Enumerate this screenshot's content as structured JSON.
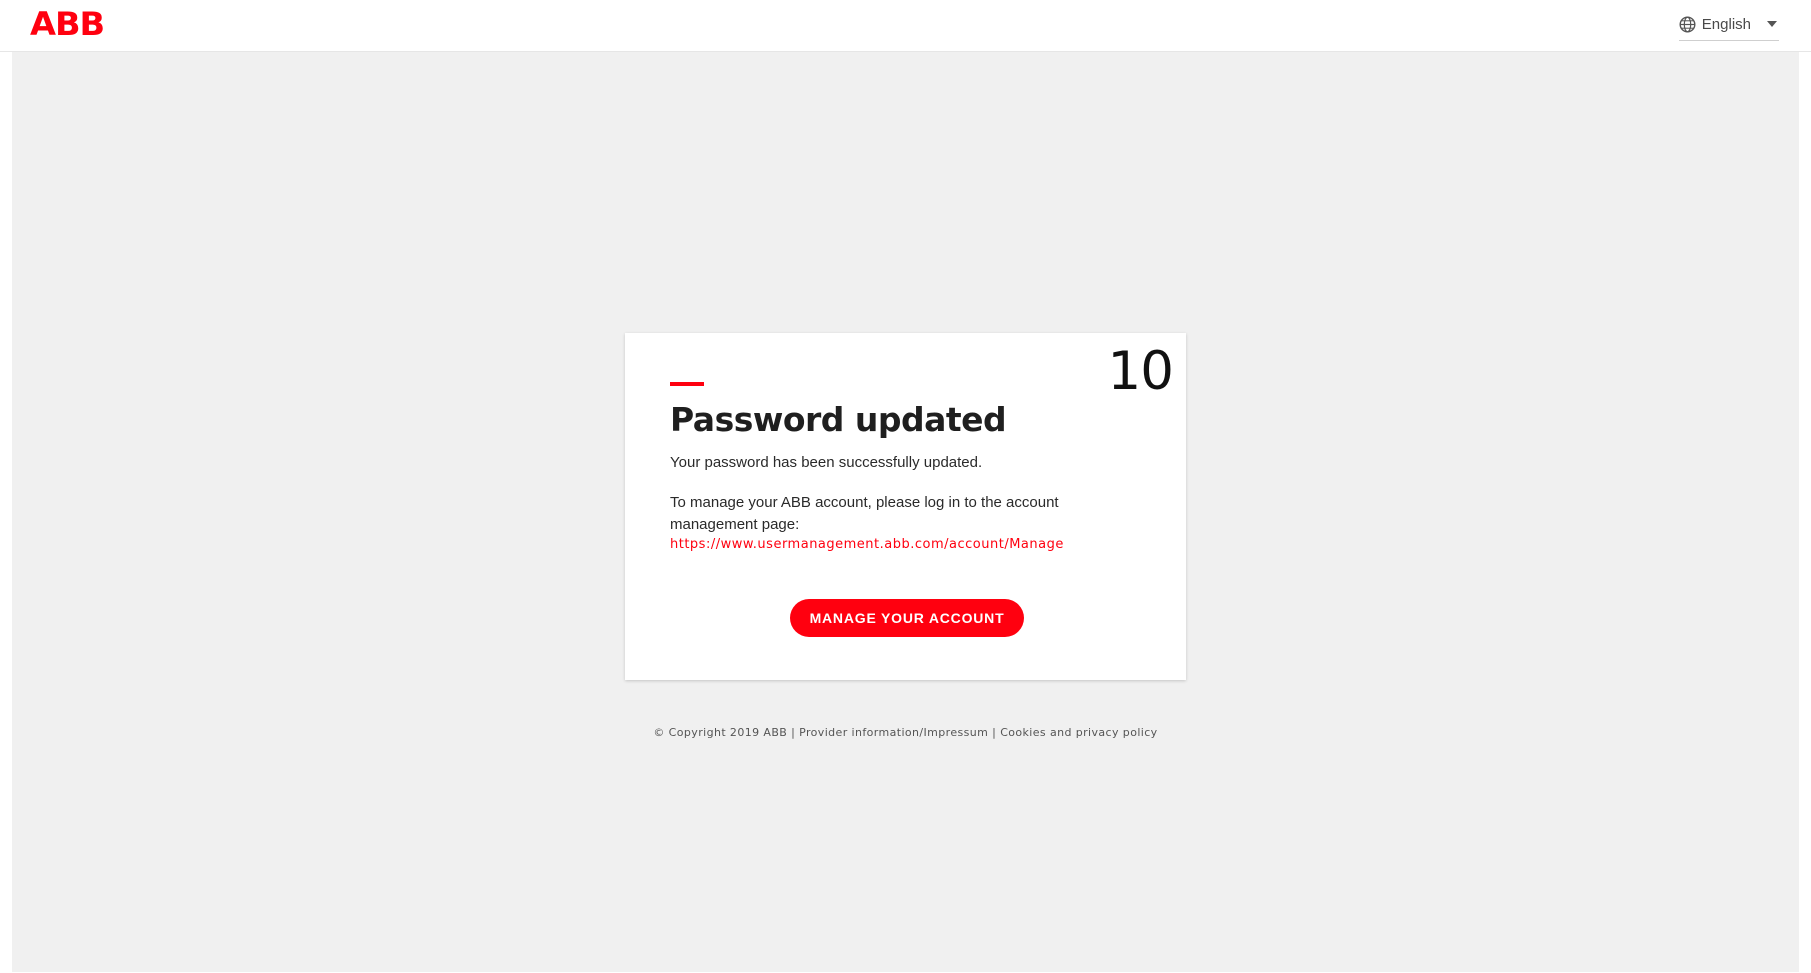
{
  "header": {
    "logo_text": "ABB",
    "language": "English",
    "brand_color": "#ff000f"
  },
  "card": {
    "countdown": "10",
    "title": "Password updated",
    "message": "Your password has been successfully updated.",
    "manage_text": "To manage your ABB account, please log in to the account management page:",
    "manage_link": "https://www.usermanagement.abb.com/account/Manage",
    "button_label": "MANAGE YOUR ACCOUNT"
  },
  "footer": {
    "copyright": "© Copyright 2019 ABB",
    "separator": " | ",
    "provider_link": "Provider information/Impressum",
    "privacy_link": "Cookies and privacy policy"
  },
  "icons": {
    "language": "globe-icon",
    "dropdown": "caret-down-icon"
  }
}
